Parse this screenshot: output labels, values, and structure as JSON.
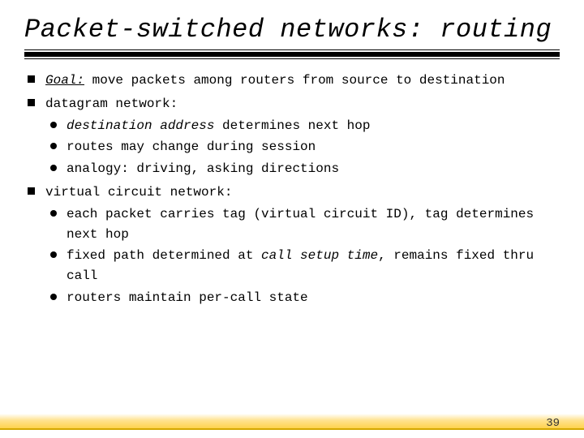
{
  "title": "Packet-switched networks: routing",
  "bullets": {
    "b1_goal": "Goal:",
    "b1_rest": " move packets among routers from source to destination",
    "b2": "datagram network:",
    "b2_sub1_it": "destination address",
    "b2_sub1_rest": " determines next hop",
    "b2_sub2": "routes may change during session",
    "b2_sub3": "analogy: driving, asking directions",
    "b3": "virtual circuit network:",
    "b3_sub1": "each packet carries tag  (virtual circuit ID), tag determines next hop",
    "b3_sub2_a": "fixed path determined at ",
    "b3_sub2_it": "call setup time",
    "b3_sub2_b": ", remains fixed thru call",
    "b3_sub3": "routers maintain per-call state"
  },
  "page_number": "39"
}
